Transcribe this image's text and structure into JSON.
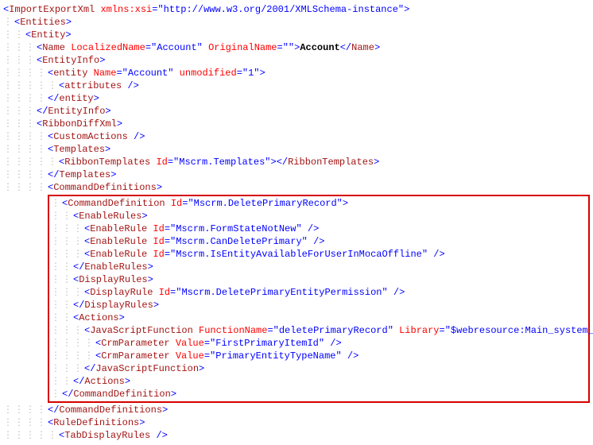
{
  "root": {
    "tag": "ImportExportXml",
    "attr1_name": "xmlns:xsi",
    "attr1_val": "http://www.w3.org/2001/XMLSchema-instance"
  },
  "entities_tag": "Entities",
  "entity_tag": "Entity",
  "name": {
    "tag": "Name",
    "a1n": "LocalizedName",
    "a1v": "Account",
    "a2n": "OriginalName",
    "a2v": "",
    "text": "Account",
    "close": "Name"
  },
  "entityinfo_tag": "EntityInfo",
  "entity_lc": {
    "tag": "entity",
    "a1n": "Name",
    "a1v": "Account",
    "a2n": "unmodified",
    "a2v": "1"
  },
  "attributes_tag": "attributes",
  "entity_lc_close": "entity",
  "entityinfo_close": "EntityInfo",
  "ribbondiff_tag": "RibbonDiffXml",
  "customactions_tag": "CustomActions",
  "templates_tag": "Templates",
  "ribbontemplates": {
    "tag": "RibbonTemplates",
    "a1n": "Id",
    "a1v": "Mscrm.Templates",
    "close": "RibbonTemplates"
  },
  "templates_close": "Templates",
  "commanddefs_tag": "CommandDefinitions",
  "cmd": {
    "open_tag": "CommandDefinition",
    "a1n": "Id",
    "a1v": "Mscrm.DeletePrimaryRecord",
    "enablerules_tag": "EnableRules",
    "er1_tag": "EnableRule",
    "er1_an": "Id",
    "er1_av": "Mscrm.FormStateNotNew",
    "er2_tag": "EnableRule",
    "er2_an": "Id",
    "er2_av": "Mscrm.CanDeletePrimary",
    "er3_tag": "EnableRule",
    "er3_an": "Id",
    "er3_av": "Mscrm.IsEntityAvailableForUserInMocaOffline",
    "enablerules_close": "EnableRules",
    "displayrules_tag": "DisplayRules",
    "dr1_tag": "DisplayRule",
    "dr1_an": "Id",
    "dr1_av": "Mscrm.DeletePrimaryEntityPermission",
    "displayrules_close": "DisplayRules",
    "actions_tag": "Actions",
    "jsf_tag": "JavaScriptFunction",
    "jsf_a1n": "FunctionName",
    "jsf_a1v": "deletePrimaryRecord",
    "jsf_a2n": "Library",
    "jsf_a2v": "$webresource:Main_system_library.js",
    "cp1_tag": "CrmParameter",
    "cp1_an": "Value",
    "cp1_av": "FirstPrimaryItemId",
    "cp2_tag": "CrmParameter",
    "cp2_an": "Value",
    "cp2_av": "PrimaryEntityTypeName",
    "jsf_close": "JavaScriptFunction",
    "actions_close": "Actions",
    "close_tag": "CommandDefinition"
  },
  "commanddefs_close": "CommandDefinitions",
  "ruledefs_tag": "RuleDefinitions",
  "tabdisplay_tag": "TabDisplayRules"
}
